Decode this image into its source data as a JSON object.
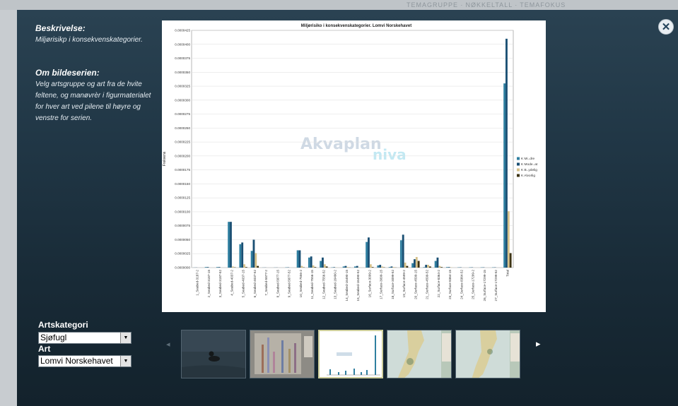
{
  "top_faint_text": "TEMAGRUPPE ∙ NØKKELTALL ∙ TEMAFOKUS",
  "close_glyph": "✕",
  "description": {
    "title": "Beskrivelse:",
    "text": "Miljørisikp i konsekvenskategorier."
  },
  "series_info": {
    "title": "Om bildeserien:",
    "text": "Velg artsgruppe og art fra de hvite feltene, og manøvrèr i figurmaterialet for hver art ved pilene til høyre og venstre for serien."
  },
  "controls": {
    "category_label": "Artskategori",
    "category_value": "Sjøfugl",
    "species_label": "Art",
    "species_value": "Lomvi Norskehavet",
    "dropdown_glyph": "▼"
  },
  "carousel": {
    "prev_glyph": "◂",
    "next_glyph": "▸",
    "selected_index": 2,
    "thumbnails": [
      "photo",
      "chart",
      "chart",
      "map",
      "map"
    ]
  },
  "watermark": {
    "word1": "Akvaplan",
    "word2": "niva"
  },
  "chart_data": {
    "type": "bar",
    "title": "Miljørisiko i konsekvenskategorier. Lomvi Norskehavet",
    "ylabel": "Frekvens",
    "xlabel": "",
    "ylim": [
      0,
      4.25e-05
    ],
    "yticks": [
      "0.0000000",
      "0.0000025",
      "0.0000050",
      "0.0000075",
      "0.0000100",
      "0.0000125",
      "0.0000150",
      "0.0000175",
      "0.0000200",
      "0.0000225",
      "0.0000250",
      "0.0000275",
      "0.0000300",
      "0.0000325",
      "0.0000350",
      "0.0000375",
      "0.0000400",
      "0.0000425"
    ],
    "categories": [
      "1_Seabed-3187-2",
      "2_Seabed-3187-15",
      "3_Seabed-3187-52",
      "4_Seabed-4037-2",
      "5_Seabed-4037-15",
      "6_Seabed-4037-52",
      "7_Seabed-5877-2",
      "8_Seabed-5877-15",
      "9_Seabed-5877-52",
      "10_Seabed-7556-2",
      "11_Seabed-7556-15",
      "12_Seabed-7556-52",
      "13_Seabed-16490-2",
      "14_Seabed-16490-15",
      "15_Seabed-16490-52",
      "16_Surface-3099-2",
      "17_Surface-3099-15",
      "18_Surface-3099-52",
      "19_Surface-4599-2",
      "20_Surface-4599-15",
      "21_Surface-4599-52",
      "22_Surface-8364-2",
      "23_Surface-8364-15",
      "24_Surface-8364-52",
      "25_Surface-17299-2",
      "26_Surface-17299-15",
      "27_Surface-17299-52",
      "Total"
    ],
    "series": [
      {
        "name": "K Mindre",
        "color": "#2f7fa0",
        "values": [
          2e-08,
          1e-07,
          1e-07,
          8.2e-06,
          4.2e-06,
          3e-06,
          2e-08,
          2e-08,
          5e-08,
          3.1e-06,
          1.8e-06,
          1.2e-06,
          5e-08,
          2e-07,
          2e-07,
          4.6e-06,
          4e-07,
          1e-07,
          4.9e-06,
          8e-07,
          8e-08,
          1.2e-06,
          1e-07,
          5e-08,
          5e-08,
          5e-08,
          5e-08,
          3.3e-05
        ]
      },
      {
        "name": "K Moderat",
        "color": "#1a4f73",
        "values": [
          2e-08,
          1e-07,
          1e-07,
          8.2e-06,
          4.5e-06,
          5e-06,
          2e-08,
          2e-08,
          5e-08,
          3.1e-06,
          2e-06,
          1.8e-06,
          8e-08,
          3e-07,
          3e-07,
          5.4e-06,
          5e-07,
          2e-07,
          5.9e-06,
          1.5e-06,
          5e-07,
          1.8e-06,
          1e-07,
          5e-08,
          5e-08,
          5e-08,
          5e-08,
          4.1e-05
        ]
      },
      {
        "name": "K Betydelig",
        "color": "#d6c189",
        "values": [
          0,
          0,
          0,
          2e-07,
          6e-07,
          2.6e-06,
          0,
          0,
          0,
          3e-07,
          4e-07,
          6e-07,
          2e-08,
          1e-07,
          5e-08,
          6e-07,
          2e-07,
          1e-07,
          9e-07,
          1.9e-06,
          5e-07,
          3e-07,
          5e-08,
          0,
          0,
          0,
          0,
          1.01e-05
        ]
      },
      {
        "name": "K Alvorlig",
        "color": "#3d3414",
        "values": [
          0,
          0,
          0,
          5e-08,
          1e-07,
          3e-07,
          0,
          0,
          0,
          5e-08,
          1e-07,
          2e-07,
          0,
          2e-08,
          0,
          1e-07,
          5e-08,
          2e-08,
          3e-07,
          1.2e-06,
          2e-07,
          1e-07,
          0,
          0,
          0,
          0,
          0,
          2.6e-06
        ]
      }
    ],
    "legend_labels": [
      "K Mi..dre",
      "K Mode..at",
      "K B..ydelig",
      "K Alvorlig"
    ],
    "legend_position": "right",
    "grid": true
  }
}
